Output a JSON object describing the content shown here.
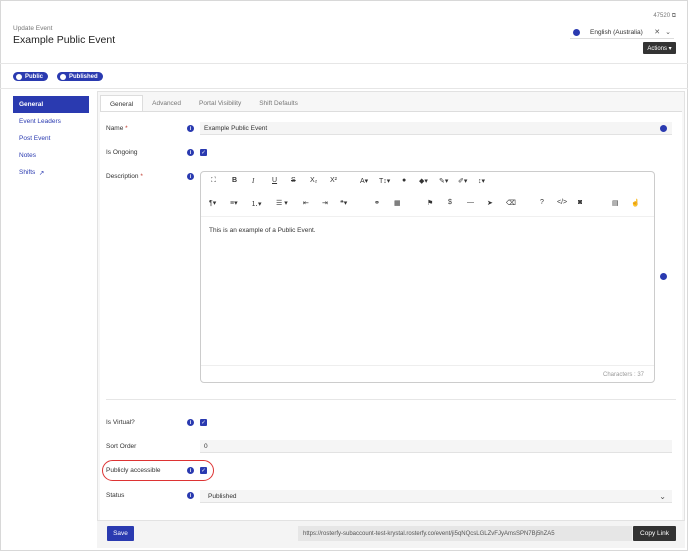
{
  "header": {
    "event_id": "47520",
    "breadcrumb": "Update Event",
    "title": "Example Public Event",
    "language": "English (Australia)",
    "actions_label": "Actions ▾"
  },
  "badges": [
    {
      "label": "Public",
      "icon": "lock-icon"
    },
    {
      "label": "Published",
      "icon": "eye-icon"
    }
  ],
  "sidebar": {
    "items": [
      {
        "label": "General",
        "active": true
      },
      {
        "label": "Event Leaders"
      },
      {
        "label": "Post Event"
      },
      {
        "label": "Notes"
      },
      {
        "label": "Shifts"
      }
    ]
  },
  "tabs": [
    "General",
    "Advanced",
    "Portal Visibility",
    "Shift Defaults"
  ],
  "form": {
    "name_label": "Name",
    "name_value": "Example Public Event",
    "ongoing_label": "Is Ongoing",
    "description_label": "Description",
    "description_text": "This is an example of a Public Event.",
    "characters": "Characters : 37",
    "virtual_label": "Is Virtual?",
    "sort_order_label": "Sort Order",
    "sort_order_value": "0",
    "public_label": "Publicly accessible",
    "status_label": "Status",
    "status_value": "Published"
  },
  "footer": {
    "save_label": "Save",
    "link": "https://rosterfy-subaccount-test-krystal.rosterfy.co/event/ji5qNQcsLGLZvFJyAmsSPN7Bj5hZA5",
    "copy_label": "Copy Link"
  },
  "colors": {
    "primary": "#2a3ab0",
    "highlight": "#d33333"
  }
}
